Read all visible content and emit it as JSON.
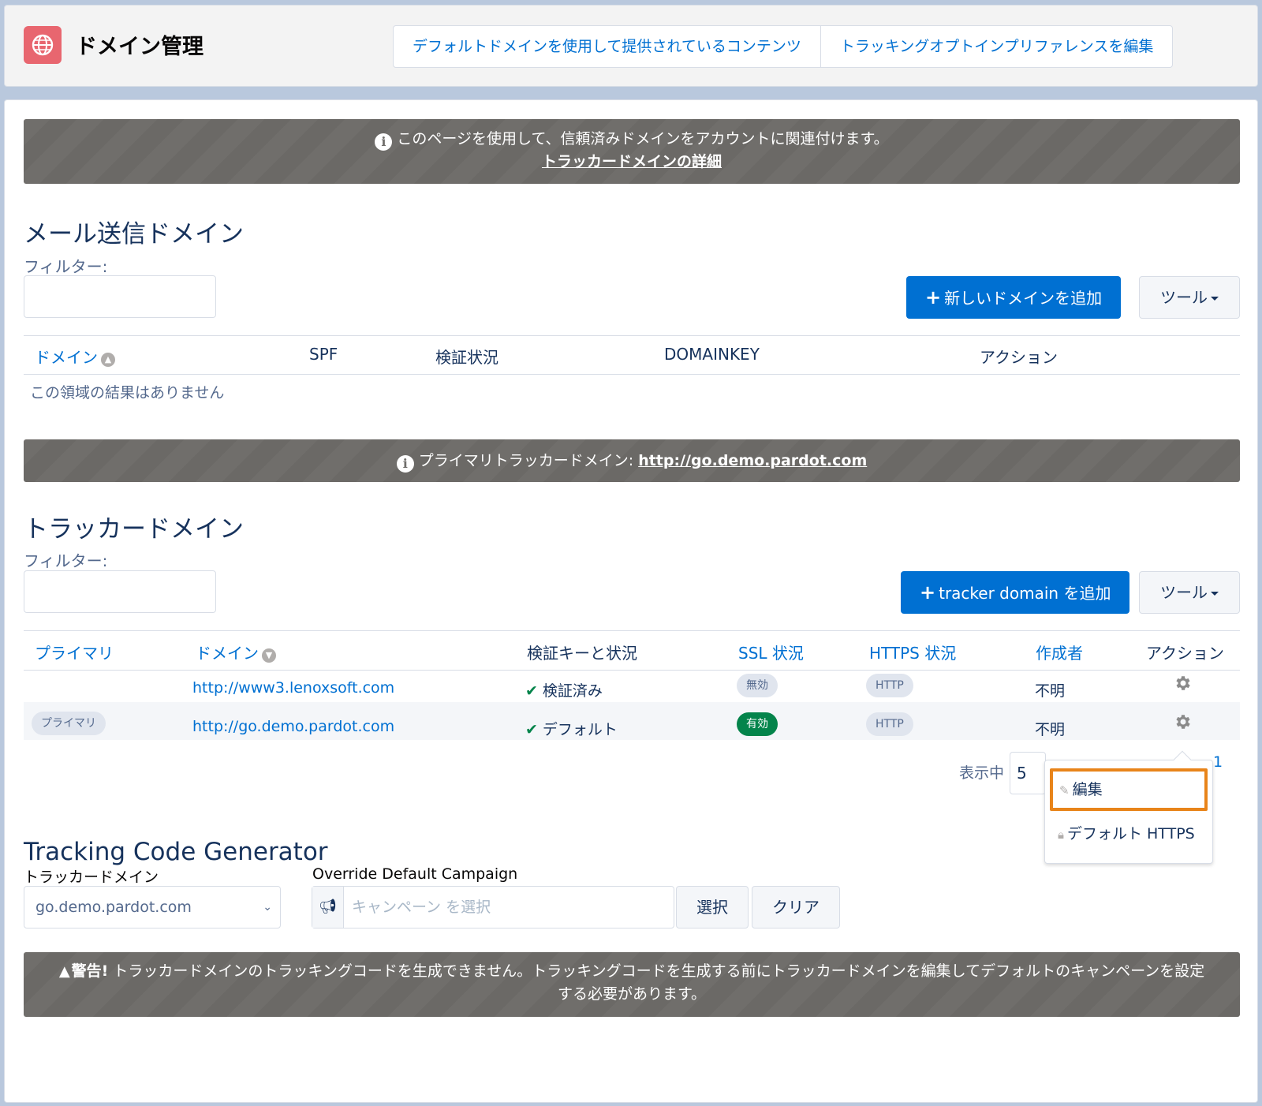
{
  "header": {
    "title": "ドメイン管理",
    "link1": "デフォルトドメインを使用して提供されているコンテンツ",
    "link2": "トラッキングオプトインプリファレンスを編集"
  },
  "info_banner": {
    "text": "このページを使用して、信頼済みドメインをアカウントに関連付けます。",
    "link": "トラッカードメインの詳細"
  },
  "email_domains": {
    "title": "メール送信ドメイン",
    "filter_label": "フィルター:",
    "filter_value": "",
    "add_button": "新しいドメインを追加",
    "tools_button": "ツール",
    "columns": [
      "ドメイン",
      "SPF",
      "検証状況",
      "DOMAINKEY",
      "アクション"
    ],
    "empty_text": "この領域の結果はありません"
  },
  "primary_banner": {
    "label": "プライマリトラッカードメイン:",
    "link": "http://go.demo.pardot.com"
  },
  "tracker_domains": {
    "title": "トラッカードメイン",
    "filter_label": "フィルター:",
    "filter_value": "",
    "add_button": "tracker domain を追加",
    "tools_button": "ツール",
    "columns": [
      "プライマリ",
      "ドメイン",
      "検証キーと状況",
      "SSL 状況",
      "HTTPS 状況",
      "作成者",
      "アクション"
    ],
    "rows": [
      {
        "primary": "",
        "domain": "http://www3.lenoxsoft.com",
        "verification": "検証済み",
        "ssl": "無効",
        "https": "HTTP",
        "creator": "不明"
      },
      {
        "primary": "プライマリ",
        "domain": "http://go.demo.pardot.com",
        "verification": "デフォルト",
        "ssl": "有効",
        "https": "HTTP",
        "creator": "不明"
      }
    ],
    "pager_label": "表示中",
    "pager_value": "5",
    "page_number": "1"
  },
  "action_menu": {
    "items": [
      "編集",
      "デフォルト HTTPS"
    ]
  },
  "tcg": {
    "title": "Tracking Code Generator",
    "domain_label": "トラッカードメイン",
    "domain_value": "go.demo.pardot.com",
    "campaign_label": "Override Default Campaign",
    "campaign_placeholder": "キャンペーン を選択",
    "select_button": "選択",
    "clear_button": "クリア"
  },
  "warning": {
    "strong": "警告!",
    "text": "トラッカードメインのトラッキングコードを生成できません。トラッキングコードを生成する前にトラッカードメインを編集してデフォルトのキャンペーンを設定する必要があります。"
  },
  "colors": {
    "link": "#0070d2",
    "primary_button": "#0070d2",
    "banner": "#706e6b",
    "header_icon": "#e8666f",
    "ssl_enabled": "#04844b",
    "menu_highlight": "#e8841a"
  }
}
